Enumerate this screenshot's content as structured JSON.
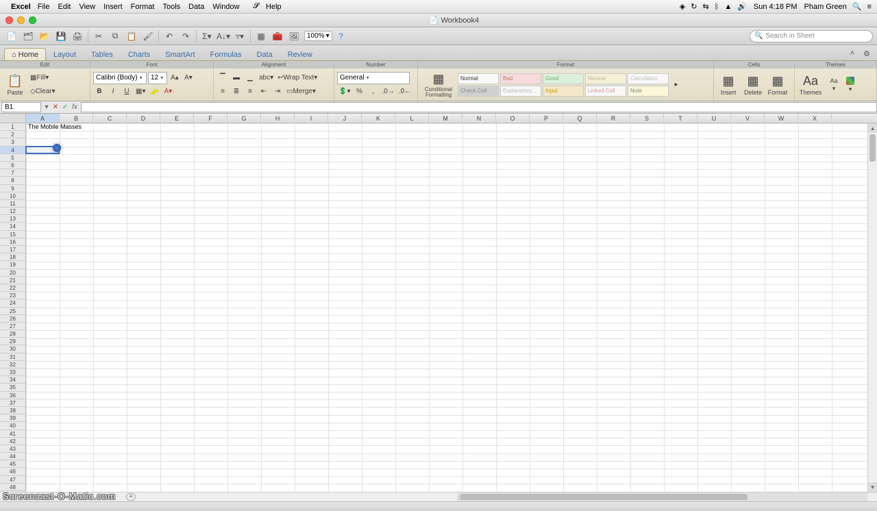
{
  "mac_menu": {
    "app": "Excel",
    "items": [
      "File",
      "Edit",
      "View",
      "Insert",
      "Format",
      "Tools",
      "Data",
      "Window",
      "Help"
    ],
    "clock": "Sun 4:18 PM",
    "user": "Pham Green"
  },
  "window": {
    "title": "Workbook4"
  },
  "qat": {
    "zoom": "100%",
    "search_placeholder": "Search in Sheet"
  },
  "ribbon": {
    "tabs": [
      "Home",
      "Layout",
      "Tables",
      "Charts",
      "SmartArt",
      "Formulas",
      "Data",
      "Review"
    ],
    "active_tab": "Home",
    "groups": [
      "Edit",
      "Font",
      "Alignment",
      "Number",
      "Format",
      "Cells",
      "Themes"
    ],
    "paste": "Paste",
    "fill": "Fill",
    "clear": "Clear",
    "font_name": "Calibri (Body)",
    "font_size": "12",
    "wrap": "Wrap Text",
    "merge": "Merge",
    "number_format": "General",
    "cond_fmt": "Conditional Formatting",
    "styles": {
      "normal": "Normal",
      "bad": "Bad",
      "good": "Good",
      "neutral": "Neutral",
      "calc": "Calculation",
      "check": "Check Cell",
      "expl": "Explanatory...",
      "input": "Input",
      "linked": "Linked Cell",
      "note": "Note"
    },
    "insert": "Insert",
    "delete": "Delete",
    "format": "Format",
    "themes": "Themes",
    "aa": "Aa"
  },
  "formula": {
    "name_box": "B1",
    "value": ""
  },
  "grid": {
    "columns": [
      "A",
      "B",
      "C",
      "D",
      "E",
      "F",
      "G",
      "H",
      "I",
      "J",
      "K",
      "L",
      "M",
      "N",
      "O",
      "P",
      "Q",
      "R",
      "S",
      "T",
      "U",
      "V",
      "W",
      "X"
    ],
    "row_count": 49,
    "selected_col": "A",
    "selected_row": 4,
    "cells": {
      "A1": "The Mobile Masses"
    }
  },
  "watermark": "Screencast-O-Matic.com"
}
